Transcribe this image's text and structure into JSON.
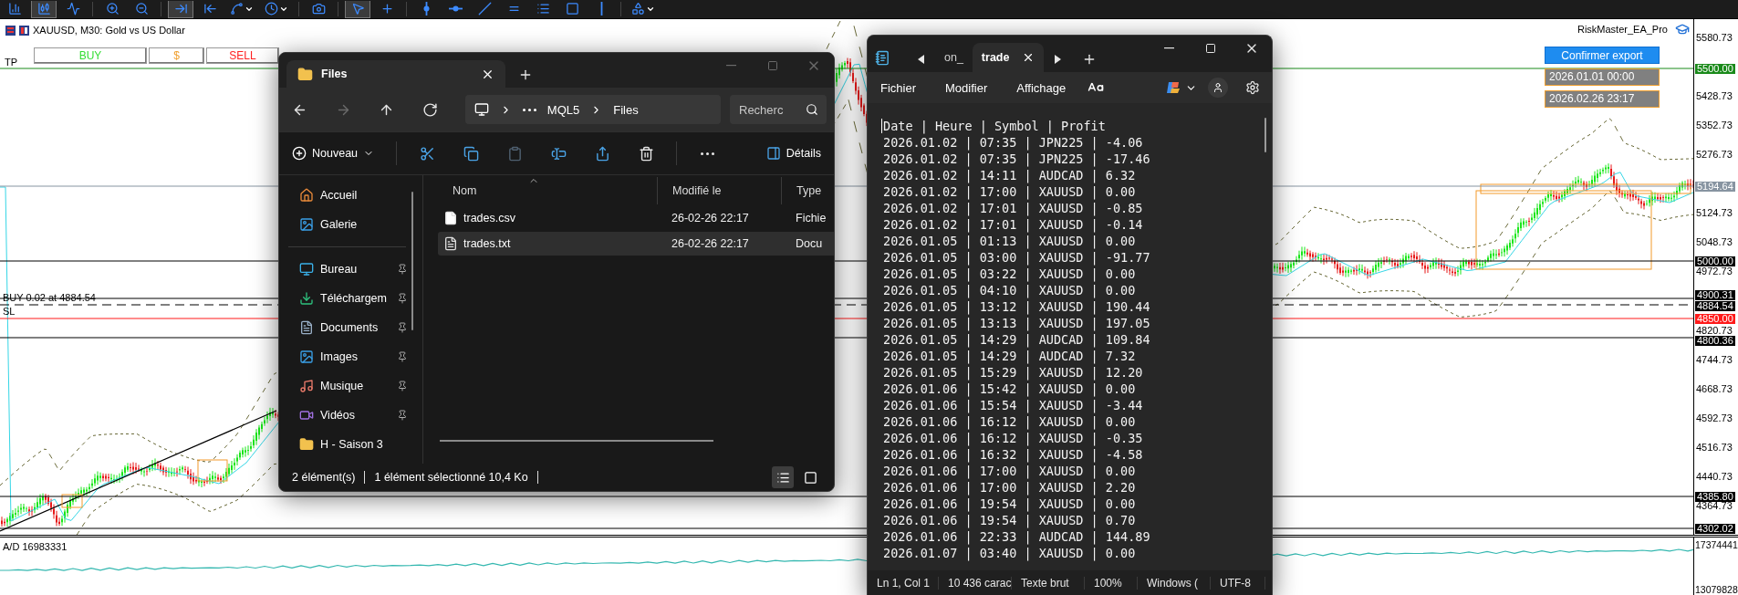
{
  "toolbar": {
    "buttons": [
      {
        "selected": false
      },
      {
        "selected": true
      },
      {
        "selected": false
      },
      {
        "selected": false
      },
      {
        "selected": false
      },
      {
        "selected": true
      },
      {
        "selected": false
      },
      {
        "selected": false
      },
      {
        "selected": false
      },
      {
        "selected": false
      },
      {
        "selected": true
      },
      {
        "selected": false
      },
      {
        "selected": false
      },
      {
        "selected": false
      },
      {
        "selected": false
      },
      {
        "selected": false
      },
      {
        "selected": false
      },
      {
        "selected": false
      },
      {
        "selected": false
      },
      {
        "selected": false
      }
    ]
  },
  "chart": {
    "title": "XAUUSD, M30:  Gold vs US Dollar",
    "trade_buttons": [
      {
        "label": "BUY",
        "color": "#33dd33"
      },
      {
        "label": "$",
        "color": "#f0a030"
      },
      {
        "label": "SELL",
        "color": "#ff2020"
      }
    ],
    "tp_label": "TP",
    "position_label": "BUY 0.02 at 4884.54",
    "sl_label": "SL",
    "ea_name": "RiskMaster_EA_Pro",
    "export_button": "Confirmer export",
    "date_fields": [
      "2026.01.01 00:00",
      "2026.02.26 23:17"
    ],
    "price_ticks": [
      "5580.73",
      "5428.73",
      "5352.73",
      "5276.73",
      "5124.73",
      "5048.73",
      "4972.73",
      "4820.73",
      "4744.73",
      "4668.73",
      "4592.73",
      "4516.73",
      "4440.73",
      "4364.73"
    ],
    "price_lines": [
      {
        "label": "5500.00",
        "color": "#1a8a1a",
        "kind": "level"
      },
      {
        "label": "5194.64",
        "color": "#8794a1",
        "kind": "level"
      },
      {
        "label": "5000.00",
        "color": "#000000",
        "kind": "level"
      },
      {
        "label": "4900.31",
        "color": "#000000",
        "kind": "level"
      },
      {
        "label": "4884.54",
        "color": "#000000",
        "kind": "position"
      },
      {
        "label": "4850.00",
        "color": "#ff1a1a",
        "kind": "level"
      },
      {
        "label": "4800.36",
        "color": "#000000",
        "kind": "level"
      },
      {
        "label": "4385.80",
        "color": "#000000",
        "kind": "level"
      },
      {
        "label": "4302.02",
        "color": "#000000",
        "kind": "level"
      }
    ],
    "indicator": {
      "label": "A/D 16983331",
      "ticks": [
        "17374441",
        "13079828"
      ]
    }
  },
  "files_window": {
    "tab_title": "Files",
    "nav": [
      {
        "disabled": false
      },
      {
        "disabled": true
      },
      {
        "disabled": false
      },
      {
        "disabled": false
      }
    ],
    "breadcrumb": [
      "MQL5",
      "Files"
    ],
    "search": {
      "placeholder": "Recherc"
    },
    "new_button": "Nouveau",
    "commands": [
      {
        "disabled": false
      },
      {
        "disabled": false
      },
      {
        "disabled": true
      },
      {
        "disabled": false
      },
      {
        "disabled": false
      },
      {
        "disabled": false
      }
    ],
    "details_button": "Détails",
    "sidebar": {
      "quick": [
        {
          "label": "Accueil"
        },
        {
          "label": "Galerie"
        }
      ],
      "places": [
        {
          "label": "Bureau",
          "pinned": true
        },
        {
          "label": "Téléchargem",
          "pinned": true
        },
        {
          "label": "Documents",
          "pinned": true
        },
        {
          "label": "Images",
          "pinned": true
        },
        {
          "label": "Musique",
          "pinned": true
        },
        {
          "label": "Vidéos",
          "pinned": true
        },
        {
          "label": "H - Saison 3",
          "pinned": false
        }
      ]
    },
    "columns": [
      "Nom",
      "Modifié le",
      "Type"
    ],
    "rows": [
      {
        "name": "trades.csv",
        "modified": "26-02-26 22:17",
        "type": "Fichie",
        "selected": false
      },
      {
        "name": "trades.txt",
        "modified": "26-02-26 22:17",
        "type": "Docu",
        "selected": true
      }
    ],
    "status": [
      "2 élément(s)",
      "1 élément sélectionné  10,4 Ko"
    ],
    "views": [
      {
        "selected": true
      },
      {
        "selected": false
      }
    ]
  },
  "notepad": {
    "tabs": [
      {
        "label": "on_",
        "selected": false
      },
      {
        "label": "trade",
        "selected": true
      }
    ],
    "menu": [
      "Fichier",
      "Modifier",
      "Affichage"
    ],
    "lines": [
      "Date | Heure | Symbol | Profit",
      "2026.01.02 | 07:35 | JPN225 | -4.06",
      "2026.01.02 | 07:35 | JPN225 | -17.46",
      "2026.01.02 | 14:11 | AUDCAD | 6.32",
      "2026.01.02 | 17:00 | XAUUSD | 0.00",
      "2026.01.02 | 17:01 | XAUUSD | -0.85",
      "2026.01.02 | 17:01 | XAUUSD | -0.14",
      "2026.01.05 | 01:13 | XAUUSD | 0.00",
      "2026.01.05 | 03:00 | XAUUSD | -91.77",
      "2026.01.05 | 03:22 | XAUUSD | 0.00",
      "2026.01.05 | 04:10 | XAUUSD | 0.00",
      "2026.01.05 | 13:12 | XAUUSD | 190.44",
      "2026.01.05 | 13:13 | XAUUSD | 197.05",
      "2026.01.05 | 14:29 | AUDCAD | 109.84",
      "2026.01.05 | 14:29 | AUDCAD | 7.32",
      "2026.01.05 | 15:29 | XAUUSD | 12.20",
      "2026.01.06 | 15:42 | XAUUSD | 0.00",
      "2026.01.06 | 15:54 | XAUUSD | -3.44",
      "2026.01.06 | 16:12 | XAUUSD | 0.00",
      "2026.01.06 | 16:12 | XAUUSD | -0.35",
      "2026.01.06 | 16:32 | XAUUSD | -4.58",
      "2026.01.06 | 17:00 | XAUUSD | 0.00",
      "2026.01.06 | 17:00 | XAUUSD | 2.20",
      "2026.01.06 | 19:54 | XAUUSD | 0.00",
      "2026.01.06 | 19:54 | XAUUSD | 0.70",
      "2026.01.06 | 22:33 | AUDCAD | 144.89",
      "2026.01.07 | 03:40 | XAUUSD | 0.00"
    ],
    "status": [
      "Ln 1, Col 1",
      "10 436 carac",
      "Texte brut",
      "100%",
      "Windows (",
      "UTF-8"
    ]
  }
}
